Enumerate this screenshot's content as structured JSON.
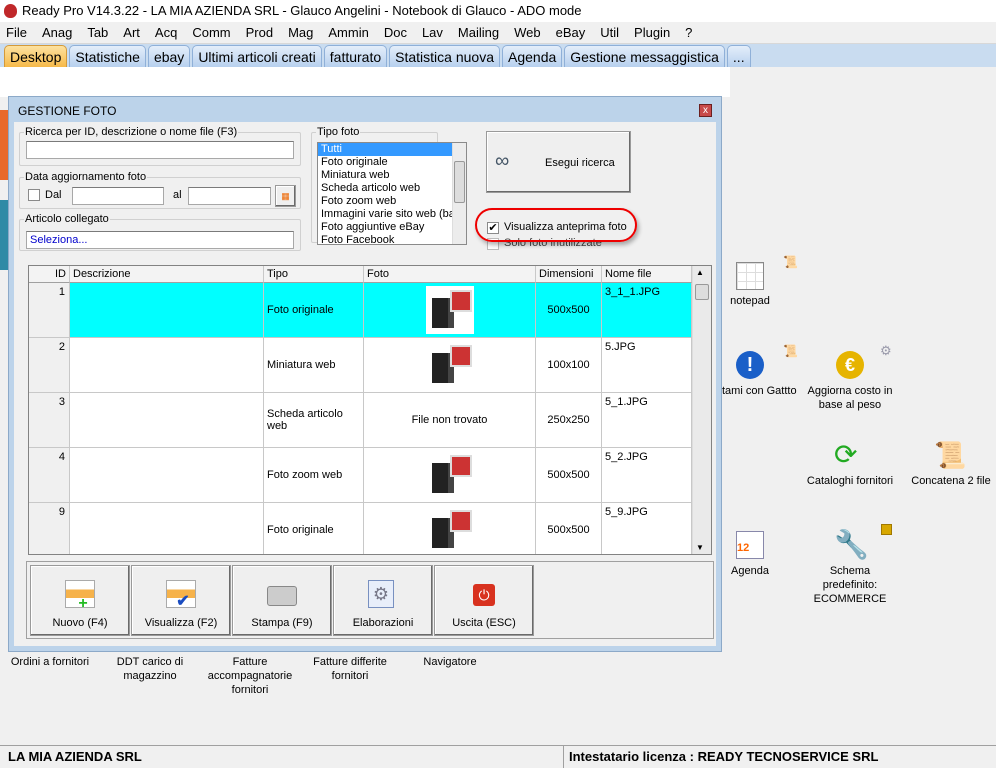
{
  "window": {
    "title": "Ready Pro V14.3.22 - LA MIA AZIENDA SRL - Glauco Angelini - Notebook di Glauco - ADO mode"
  },
  "menu": [
    "File",
    "Anag",
    "Tab",
    "Art",
    "Acq",
    "Comm",
    "Prod",
    "Mag",
    "Ammin",
    "Doc",
    "Lav",
    "Mailing",
    "Web",
    "eBay",
    "Util",
    "Plugin",
    "?"
  ],
  "tabs": [
    {
      "label": "Desktop",
      "active": true
    },
    {
      "label": "Statistiche"
    },
    {
      "label": "ebay"
    },
    {
      "label": "Ultimi articoli creati"
    },
    {
      "label": "fatturato"
    },
    {
      "label": "Statistica nuova"
    },
    {
      "label": "Agenda"
    },
    {
      "label": "Gestione messaggistica"
    },
    {
      "label": "..."
    }
  ],
  "dialog": {
    "title": "GESTIONE FOTO",
    "close": "x",
    "search": {
      "legend": "Ricerca per ID, descrizione o nome file (F3)",
      "value": ""
    },
    "date": {
      "legend": "Data aggiornamento foto",
      "dal_label": "Dal",
      "al_label": "al",
      "dal_value": "",
      "al_value": "",
      "checked": false
    },
    "articolo": {
      "legend": "Articolo collegato",
      "value": "Seleziona..."
    },
    "tipo": {
      "legend": "Tipo foto",
      "options": [
        "Tutti",
        "Foto originale",
        "Miniatura web",
        "Scheda articolo web",
        "Foto zoom web",
        "Immagini varie sito web (ban",
        "Foto aggiuntive eBay",
        "Foto Facebook"
      ],
      "selected": "Tutti"
    },
    "search_button": "Esegui ricerca",
    "preview_check": {
      "label": "Visualizza anteprima foto",
      "checked": true
    },
    "unused_check": {
      "label": "Solo foto inutilizzate",
      "checked": false
    },
    "columns": [
      "ID",
      "Descrizione",
      "Tipo",
      "Foto",
      "Dimensioni",
      "Nome file"
    ],
    "rows": [
      {
        "id": "1",
        "descrizione": "",
        "tipo": "Foto originale",
        "foto": "",
        "dimensioni": "500x500",
        "nome": "3_1_1.JPG",
        "selected": true
      },
      {
        "id": "2",
        "descrizione": "",
        "tipo": "Miniatura web",
        "foto": "",
        "dimensioni": "100x100",
        "nome": "5.JPG"
      },
      {
        "id": "3",
        "descrizione": "",
        "tipo": "Scheda articolo web",
        "foto": "File non trovato",
        "dimensioni": "250x250",
        "nome": "5_1.JPG"
      },
      {
        "id": "4",
        "descrizione": "",
        "tipo": "Foto zoom web",
        "foto": "",
        "dimensioni": "500x500",
        "nome": "5_2.JPG"
      },
      {
        "id": "9",
        "descrizione": "",
        "tipo": "Foto originale",
        "foto": "",
        "dimensioni": "500x500",
        "nome": "5_9.JPG"
      }
    ],
    "buttons": [
      "Nuovo (F4)",
      "Visualizza (F2)",
      "Stampa (F9)",
      "Elaborazioni",
      "Uscita (ESC)"
    ]
  },
  "desktop": {
    "bottom_items": [
      "Ordini a fornitori",
      "DDT carico di magazzino",
      "Fatture accompagnatorie fornitori",
      "Fatture differite fornitori",
      "Navigatore"
    ],
    "right_items": [
      "notepad",
      "tami con Gattto",
      "Aggiorna costo in base al peso",
      "Cataloghi fornitori",
      "Concatena 2 file",
      "Agenda",
      "Schema predefinito: ECOMMERCE"
    ]
  },
  "status": {
    "left": "LA MIA AZIENDA SRL",
    "right": "Intestatario licenza : READY TECNOSERVICE SRL"
  },
  "colors": {
    "selected_row": "#00ffff",
    "highlight_ring": "#ee0000",
    "active_tab": "#f6b94a"
  }
}
